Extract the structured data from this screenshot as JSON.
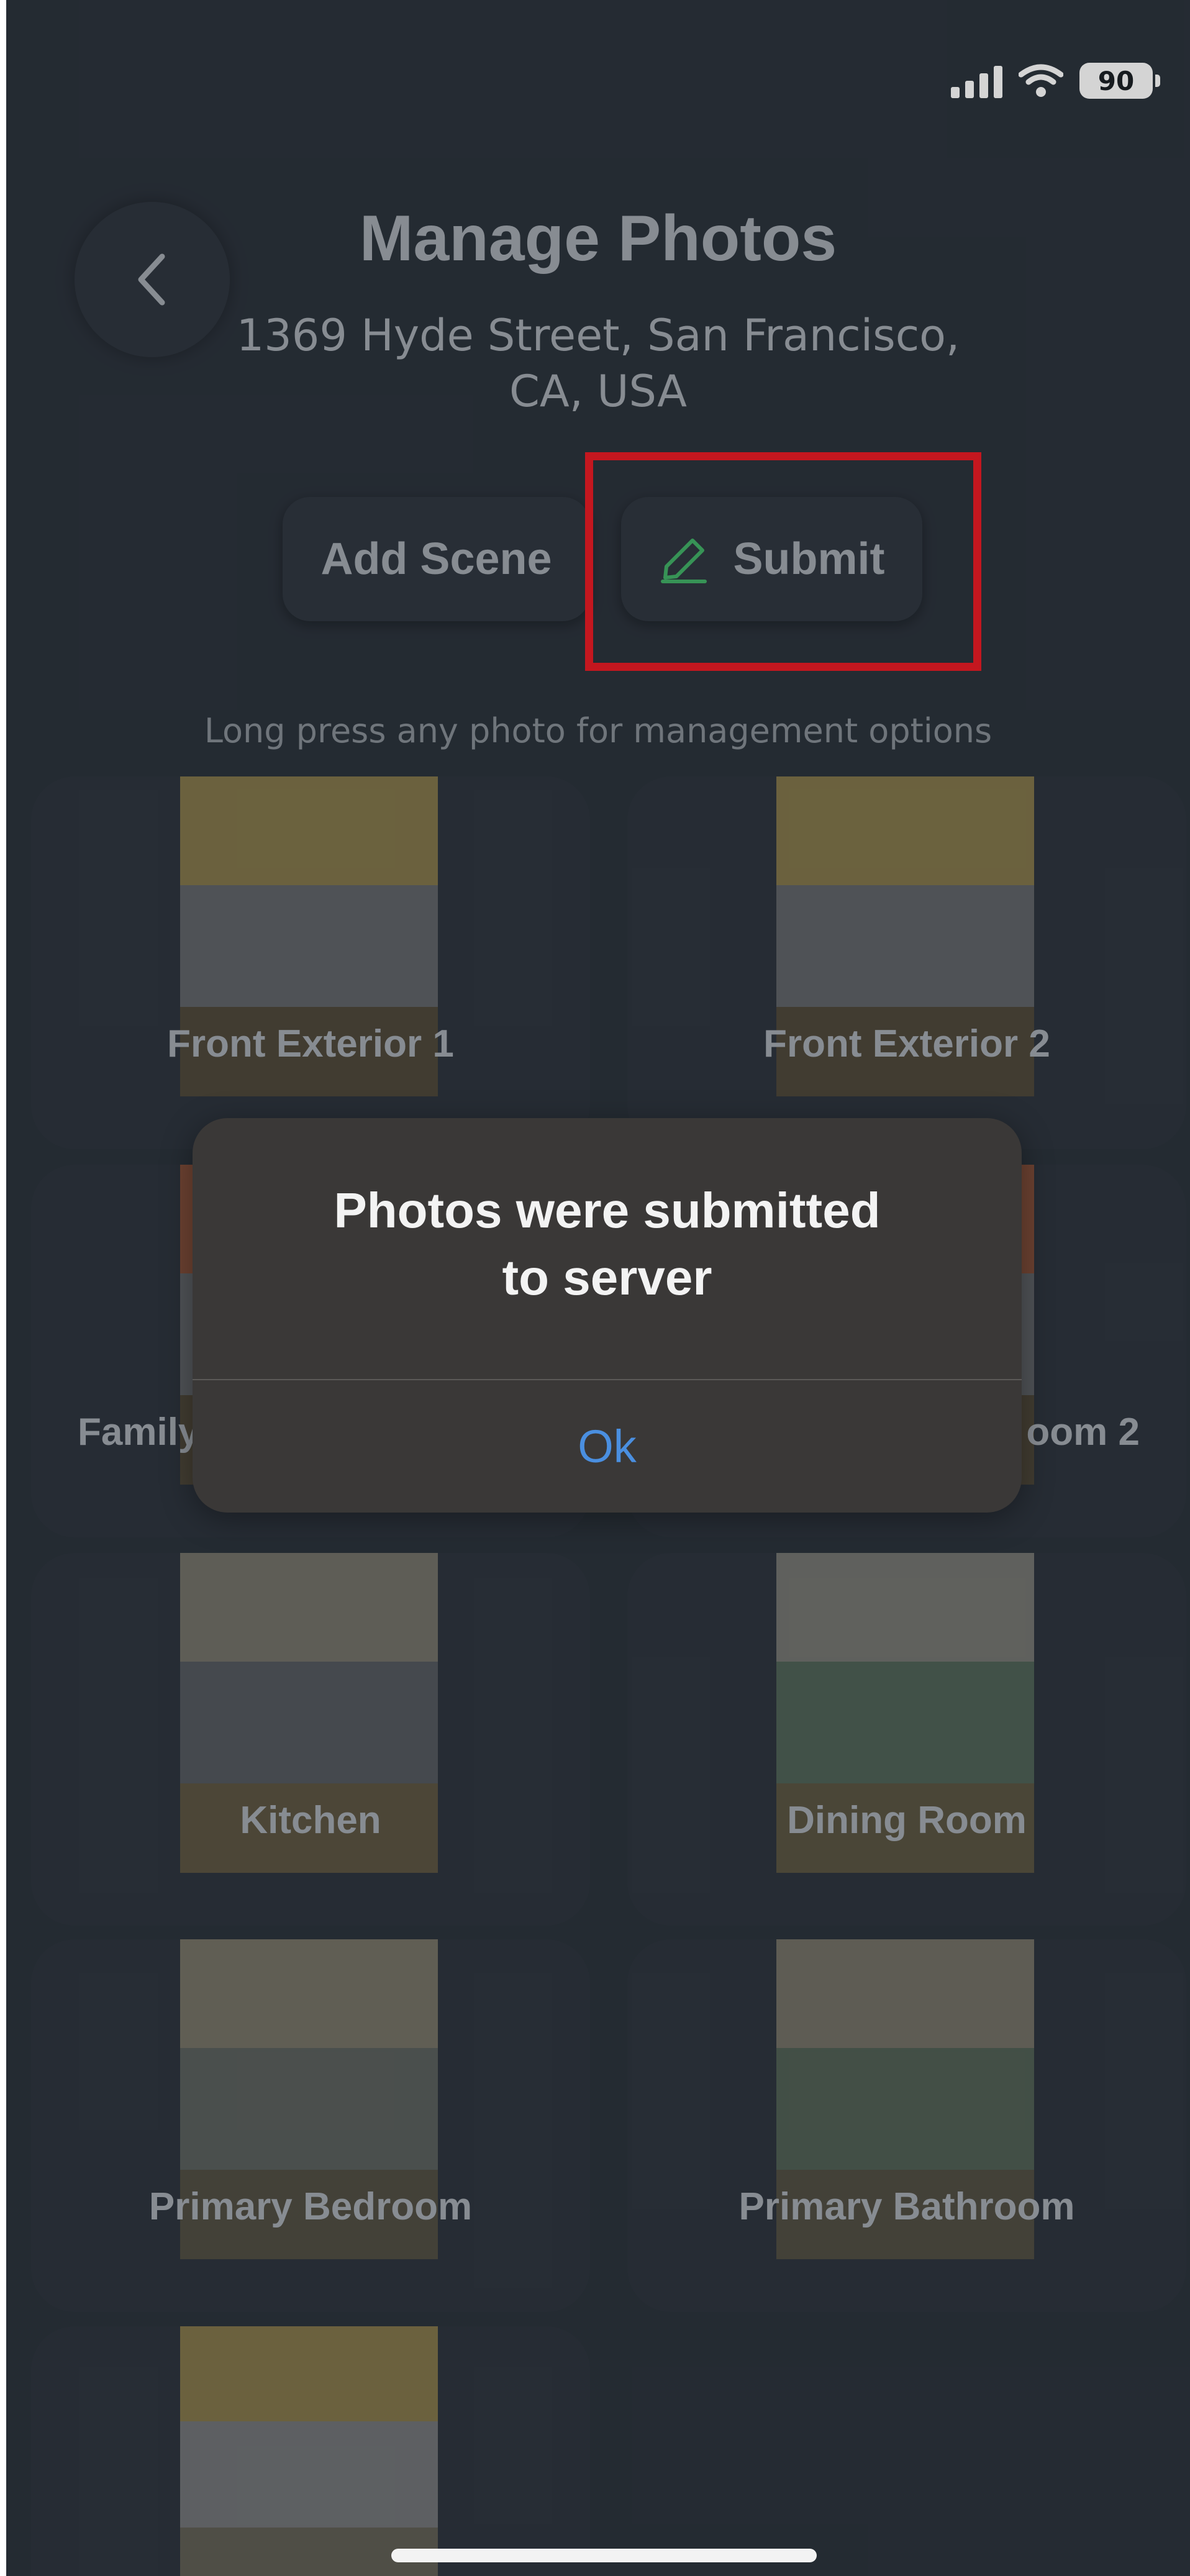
{
  "status_bar": {
    "battery": "90",
    "icons": [
      "signal-icon",
      "wifi-icon",
      "battery-icon"
    ]
  },
  "header": {
    "back_icon": "chevron-left-icon",
    "title": "Manage Photos",
    "address_line1": "1369 Hyde Street, San Francisco,",
    "address_line2": "CA, USA"
  },
  "actions": {
    "add_scene_label": "Add Scene",
    "submit_label": "Submit",
    "submit_icon": "pencil-icon"
  },
  "hint": "Long press any photo for management options",
  "scenes": [
    {
      "label": "Front Exterior 1"
    },
    {
      "label": "Front Exterior 2"
    },
    {
      "label": "Family"
    },
    {
      "label": "oom 2"
    },
    {
      "label": "Kitchen"
    },
    {
      "label": "Dining Room"
    },
    {
      "label": "Primary Bedroom"
    },
    {
      "label": "Primary Bathroom"
    }
  ],
  "alert": {
    "line1": "Photos were submitted",
    "line2": "to server",
    "ok_label": "Ok"
  },
  "colors": {
    "background": "#2a313a",
    "highlight": "#e01b24",
    "alert_ok": "#4a8fe0",
    "submit_icon": "#3fa862"
  }
}
